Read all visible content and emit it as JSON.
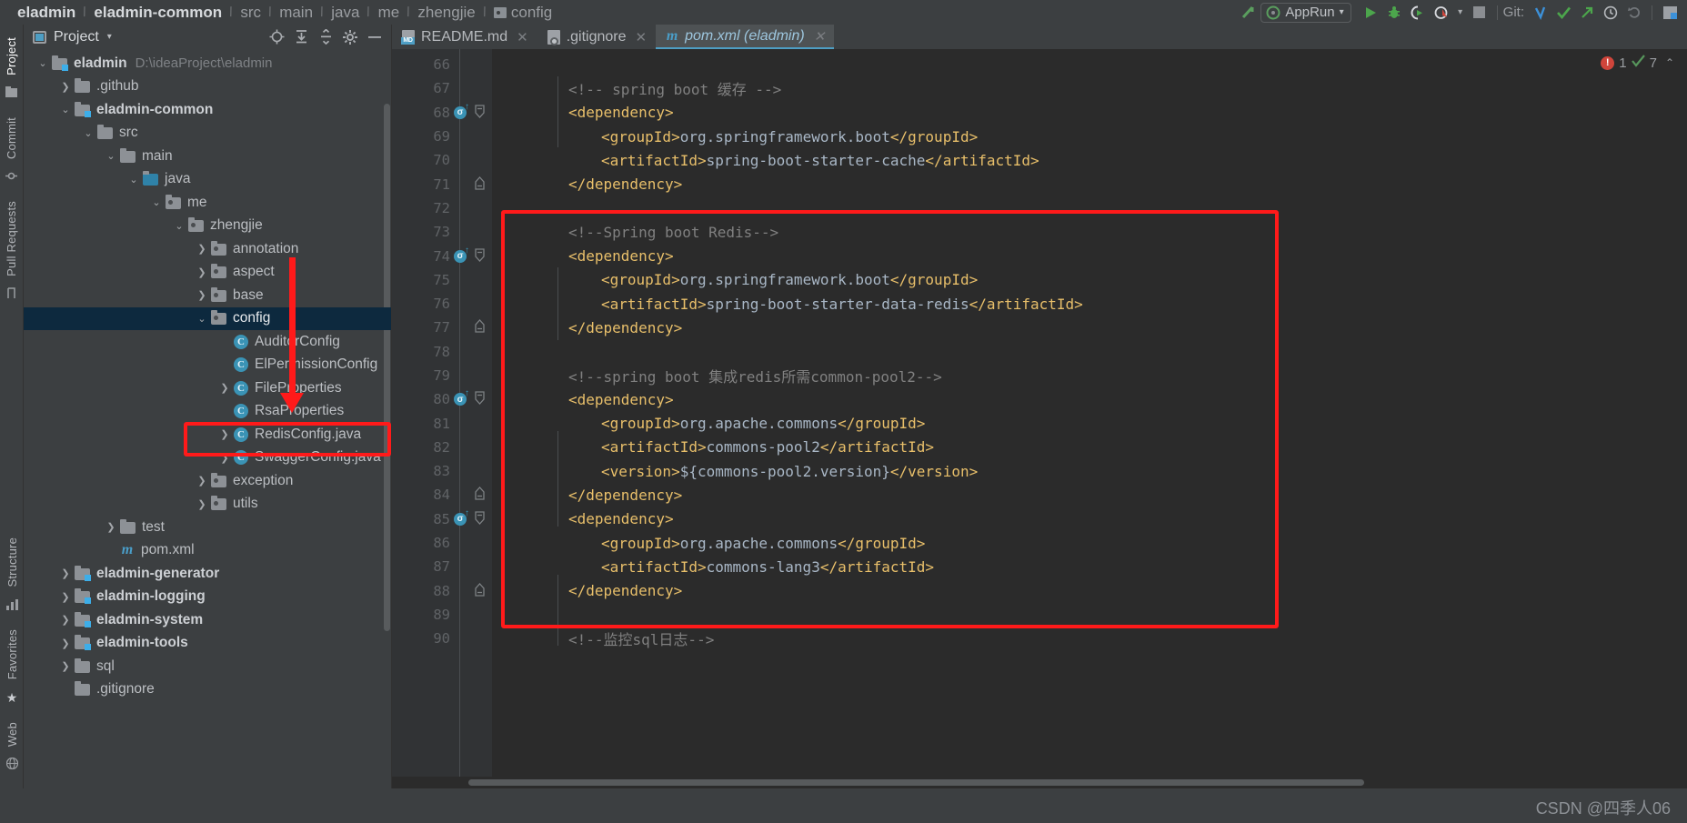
{
  "breadcrumb": {
    "items": [
      {
        "label": "eladmin",
        "bold": true
      },
      {
        "label": "eladmin-common",
        "bold": true
      },
      {
        "label": "src",
        "bold": false
      },
      {
        "label": "main",
        "bold": false
      },
      {
        "label": "java",
        "bold": false
      },
      {
        "label": "me",
        "bold": false
      },
      {
        "label": "zhengjie",
        "bold": false
      },
      {
        "label": "config",
        "bold": false
      }
    ],
    "separator": "/"
  },
  "toolbar": {
    "run_config_label": "AppRun",
    "git_label": "Git:",
    "icons": [
      "build-icon",
      "run-icon",
      "debug-icon",
      "run-with-coverage-icon",
      "profile-icon",
      "stop-icon",
      "git-update-icon",
      "git-commit-icon",
      "git-push-icon",
      "git-history-icon",
      "git-rollback-icon",
      "layout-icon"
    ]
  },
  "leftstrip": {
    "top_tabs": [
      "Project",
      "Commit",
      "Pull Requests"
    ],
    "bottom_tabs": [
      "Structure",
      "Favorites",
      "Web"
    ]
  },
  "project_panel": {
    "title": "Project",
    "header_icons": [
      "locate-icon",
      "expand-all-icon",
      "collapse-all-icon",
      "settings-icon",
      "hide-icon"
    ],
    "tree": [
      {
        "depth": 0,
        "arrow": "v",
        "icon": "module-folder",
        "label": "eladmin",
        "bold": true,
        "path": "D:\\ideaProject\\eladmin",
        "selected": false
      },
      {
        "depth": 1,
        "arrow": ">",
        "icon": "plain-folder",
        "label": ".github",
        "bold": false,
        "path": "",
        "selected": false
      },
      {
        "depth": 1,
        "arrow": "v",
        "icon": "module-folder",
        "label": "eladmin-common",
        "bold": true,
        "path": "",
        "selected": false
      },
      {
        "depth": 2,
        "arrow": "v",
        "icon": "plain-folder",
        "label": "src",
        "bold": false,
        "path": "",
        "selected": false
      },
      {
        "depth": 3,
        "arrow": "v",
        "icon": "plain-folder",
        "label": "main",
        "bold": false,
        "path": "",
        "selected": false
      },
      {
        "depth": 4,
        "arrow": "v",
        "icon": "src-folder",
        "label": "java",
        "bold": false,
        "path": "",
        "selected": false
      },
      {
        "depth": 5,
        "arrow": "v",
        "icon": "package",
        "label": "me",
        "bold": false,
        "path": "",
        "selected": false
      },
      {
        "depth": 6,
        "arrow": "v",
        "icon": "package",
        "label": "zhengjie",
        "bold": false,
        "path": "",
        "selected": false
      },
      {
        "depth": 7,
        "arrow": ">",
        "icon": "package",
        "label": "annotation",
        "bold": false,
        "path": "",
        "selected": false
      },
      {
        "depth": 7,
        "arrow": ">",
        "icon": "package",
        "label": "aspect",
        "bold": false,
        "path": "",
        "selected": false
      },
      {
        "depth": 7,
        "arrow": ">",
        "icon": "package",
        "label": "base",
        "bold": false,
        "path": "",
        "selected": false
      },
      {
        "depth": 7,
        "arrow": "v",
        "icon": "package",
        "label": "config",
        "bold": false,
        "path": "",
        "selected": true
      },
      {
        "depth": 8,
        "arrow": "",
        "icon": "class",
        "label": "AuditorConfig",
        "bold": false,
        "path": "",
        "selected": false
      },
      {
        "depth": 8,
        "arrow": "",
        "icon": "class",
        "label": "ElPermissionConfig",
        "bold": false,
        "path": "",
        "selected": false
      },
      {
        "depth": 8,
        "arrow": ">",
        "icon": "class",
        "label": "FileProperties",
        "bold": false,
        "path": "",
        "selected": false
      },
      {
        "depth": 8,
        "arrow": "",
        "icon": "class",
        "label": "RsaProperties",
        "bold": false,
        "path": "",
        "selected": false
      },
      {
        "depth": 8,
        "arrow": ">",
        "icon": "class",
        "label": "RedisConfig.java",
        "bold": false,
        "path": "",
        "selected": false
      },
      {
        "depth": 8,
        "arrow": ">",
        "icon": "class",
        "label": "SwaggerConfig.java",
        "bold": false,
        "path": "",
        "selected": false
      },
      {
        "depth": 7,
        "arrow": ">",
        "icon": "package",
        "label": "exception",
        "bold": false,
        "path": "",
        "selected": false
      },
      {
        "depth": 7,
        "arrow": ">",
        "icon": "package",
        "label": "utils",
        "bold": false,
        "path": "",
        "selected": false
      },
      {
        "depth": 3,
        "arrow": ">",
        "icon": "plain-folder",
        "label": "test",
        "bold": false,
        "path": "",
        "selected": false
      },
      {
        "depth": 3,
        "arrow": "",
        "icon": "maven",
        "label": "pom.xml",
        "bold": false,
        "path": "",
        "selected": false
      },
      {
        "depth": 1,
        "arrow": ">",
        "icon": "module-folder",
        "label": "eladmin-generator",
        "bold": true,
        "path": "",
        "selected": false
      },
      {
        "depth": 1,
        "arrow": ">",
        "icon": "module-folder",
        "label": "eladmin-logging",
        "bold": true,
        "path": "",
        "selected": false
      },
      {
        "depth": 1,
        "arrow": ">",
        "icon": "module-folder",
        "label": "eladmin-system",
        "bold": true,
        "path": "",
        "selected": false
      },
      {
        "depth": 1,
        "arrow": ">",
        "icon": "module-folder",
        "label": "eladmin-tools",
        "bold": true,
        "path": "",
        "selected": false
      },
      {
        "depth": 1,
        "arrow": ">",
        "icon": "plain-folder",
        "label": "sql",
        "bold": false,
        "path": "",
        "selected": false
      },
      {
        "depth": 1,
        "arrow": "",
        "icon": "plain-folder",
        "label": ".gitignore",
        "bold": false,
        "path": "",
        "selected": false
      }
    ]
  },
  "editor": {
    "tabs": [
      {
        "label": "README.md",
        "icon": "markdown-file-icon",
        "active": false,
        "closable": true
      },
      {
        "label": ".gitignore",
        "icon": "gitignore-file-icon",
        "active": false,
        "closable": true
      },
      {
        "label": "pom.xml (eladmin)",
        "icon": "maven-file-icon",
        "active": true,
        "closable": true
      }
    ],
    "inspection": {
      "error_count": "1",
      "warning_count": "7",
      "warning_glyph": "✓"
    },
    "first_line_number": 66,
    "lines": [
      {
        "n": 66,
        "indent": 0,
        "badge": false,
        "fold": "",
        "segs": []
      },
      {
        "n": 67,
        "indent": 2,
        "badge": false,
        "fold": "",
        "segs": [
          {
            "t": "cmt",
            "s": "<!-- spring boot 缓存 -->"
          }
        ]
      },
      {
        "n": 68,
        "indent": 2,
        "badge": true,
        "fold": "−",
        "segs": [
          {
            "t": "tag",
            "s": "<dependency>"
          }
        ]
      },
      {
        "n": 69,
        "indent": 3,
        "badge": false,
        "fold": "",
        "segs": [
          {
            "t": "tag",
            "s": "<groupId>"
          },
          {
            "t": "txt",
            "s": "org.springframework.boot"
          },
          {
            "t": "tag",
            "s": "</groupId>"
          }
        ]
      },
      {
        "n": 70,
        "indent": 3,
        "badge": false,
        "fold": "",
        "segs": [
          {
            "t": "tag",
            "s": "<artifactId>"
          },
          {
            "t": "txt",
            "s": "spring-boot-starter-cache"
          },
          {
            "t": "tag",
            "s": "</artifactId>"
          }
        ]
      },
      {
        "n": 71,
        "indent": 2,
        "badge": false,
        "fold": "⌃",
        "segs": [
          {
            "t": "tag",
            "s": "</dependency>"
          }
        ]
      },
      {
        "n": 72,
        "indent": 0,
        "badge": false,
        "fold": "",
        "segs": []
      },
      {
        "n": 73,
        "indent": 2,
        "badge": false,
        "fold": "",
        "segs": [
          {
            "t": "cmt",
            "s": "<!--Spring boot Redis-->"
          }
        ]
      },
      {
        "n": 74,
        "indent": 2,
        "badge": true,
        "fold": "−",
        "segs": [
          {
            "t": "tag",
            "s": "<dependency>"
          }
        ]
      },
      {
        "n": 75,
        "indent": 3,
        "badge": false,
        "fold": "",
        "segs": [
          {
            "t": "tag",
            "s": "<groupId>"
          },
          {
            "t": "txt",
            "s": "org.springframework.boot"
          },
          {
            "t": "tag",
            "s": "</groupId>"
          }
        ]
      },
      {
        "n": 76,
        "indent": 3,
        "badge": false,
        "fold": "",
        "segs": [
          {
            "t": "tag",
            "s": "<artifactId>"
          },
          {
            "t": "txt",
            "s": "spring-boot-starter-data-redis"
          },
          {
            "t": "tag",
            "s": "</artifactId>"
          }
        ]
      },
      {
        "n": 77,
        "indent": 2,
        "badge": false,
        "fold": "⌃",
        "segs": [
          {
            "t": "tag",
            "s": "</dependency>"
          }
        ]
      },
      {
        "n": 78,
        "indent": 0,
        "badge": false,
        "fold": "",
        "segs": []
      },
      {
        "n": 79,
        "indent": 2,
        "badge": false,
        "fold": "",
        "segs": [
          {
            "t": "cmt",
            "s": "<!--spring boot 集成redis所需common-pool2-->"
          }
        ]
      },
      {
        "n": 80,
        "indent": 2,
        "badge": true,
        "fold": "−",
        "segs": [
          {
            "t": "tag",
            "s": "<dependency>"
          }
        ]
      },
      {
        "n": 81,
        "indent": 3,
        "badge": false,
        "fold": "",
        "segs": [
          {
            "t": "tag",
            "s": "<groupId>"
          },
          {
            "t": "txt",
            "s": "org.apache.commons"
          },
          {
            "t": "tag",
            "s": "</groupId>"
          }
        ]
      },
      {
        "n": 82,
        "indent": 3,
        "badge": false,
        "fold": "",
        "segs": [
          {
            "t": "tag",
            "s": "<artifactId>"
          },
          {
            "t": "txt",
            "s": "commons-pool2"
          },
          {
            "t": "tag",
            "s": "</artifactId>"
          }
        ]
      },
      {
        "n": 83,
        "indent": 3,
        "badge": false,
        "fold": "",
        "segs": [
          {
            "t": "tag",
            "s": "<version>"
          },
          {
            "t": "txt",
            "s": "${commons-pool2.version}"
          },
          {
            "t": "tag",
            "s": "</version>"
          }
        ]
      },
      {
        "n": 84,
        "indent": 2,
        "badge": false,
        "fold": "⌃",
        "segs": [
          {
            "t": "tag",
            "s": "</dependency>"
          }
        ]
      },
      {
        "n": 85,
        "indent": 2,
        "badge": true,
        "fold": "−",
        "segs": [
          {
            "t": "tag",
            "s": "<dependency>"
          }
        ]
      },
      {
        "n": 86,
        "indent": 3,
        "badge": false,
        "fold": "",
        "segs": [
          {
            "t": "tag",
            "s": "<groupId>"
          },
          {
            "t": "txt",
            "s": "org.apache.commons"
          },
          {
            "t": "tag",
            "s": "</groupId>"
          }
        ]
      },
      {
        "n": 87,
        "indent": 3,
        "badge": false,
        "fold": "",
        "segs": [
          {
            "t": "tag",
            "s": "<artifactId>"
          },
          {
            "t": "txt",
            "s": "commons-lang3"
          },
          {
            "t": "tag",
            "s": "</artifactId>"
          }
        ]
      },
      {
        "n": 88,
        "indent": 2,
        "badge": false,
        "fold": "⌃",
        "segs": [
          {
            "t": "tag",
            "s": "</dependency>"
          }
        ]
      },
      {
        "n": 89,
        "indent": 0,
        "badge": false,
        "fold": "",
        "segs": []
      },
      {
        "n": 90,
        "indent": 2,
        "badge": false,
        "fold": "",
        "segs": [
          {
            "t": "cmt",
            "s": "<!--监控sql日志-->"
          }
        ]
      }
    ]
  },
  "annotations": {
    "color": "#ff1a1a",
    "code_box": {
      "label": "redis-dependency-highlight-box"
    },
    "tree_box": {
      "label": "redisconfig-highlight-box"
    },
    "arrow": {
      "label": "pointer-arrow-to-redisconfig"
    }
  },
  "footer": {
    "watermark": "CSDN @四季人06"
  }
}
